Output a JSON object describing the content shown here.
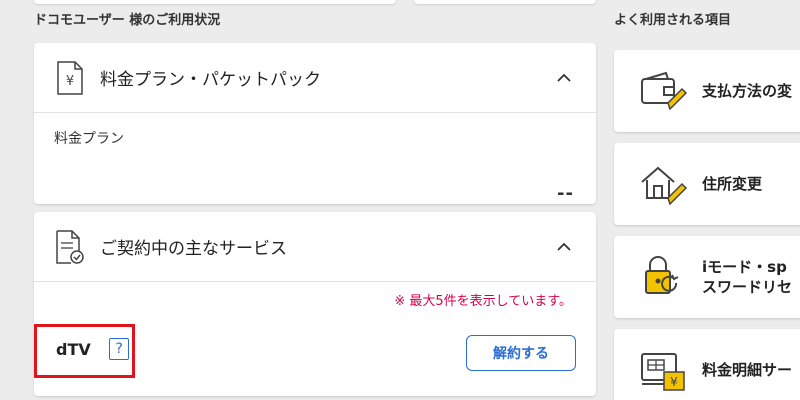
{
  "header": {
    "usage_title": "ドコモユーザー 様のご利用状況",
    "frequent_title": "よく利用される項目"
  },
  "plan_card": {
    "title": "料金プラン・パケットパック",
    "plan_label": "料金プラン",
    "plan_value": "--"
  },
  "services_card": {
    "title": "ご契約中の主なサービス",
    "note": "※ 最大5件を表示しています。",
    "service_name": "dTV",
    "help_label": "?",
    "cancel_label": "解約する"
  },
  "frequent_items": [
    {
      "label": "支払方法の変",
      "icon": "wallet-pencil-icon"
    },
    {
      "label": "住所変更",
      "icon": "house-pencil-icon"
    },
    {
      "label_line1": "iモード・sp",
      "label_line2": "スワードリセ",
      "icon": "lock-reset-icon"
    },
    {
      "label": "料金明細サー",
      "icon": "statement-yen-icon"
    }
  ],
  "colors": {
    "accent_blue": "#2a6dd6",
    "note_red": "#d6004b",
    "highlight_red": "#e0141b",
    "icon_yellow": "#f3c300"
  }
}
